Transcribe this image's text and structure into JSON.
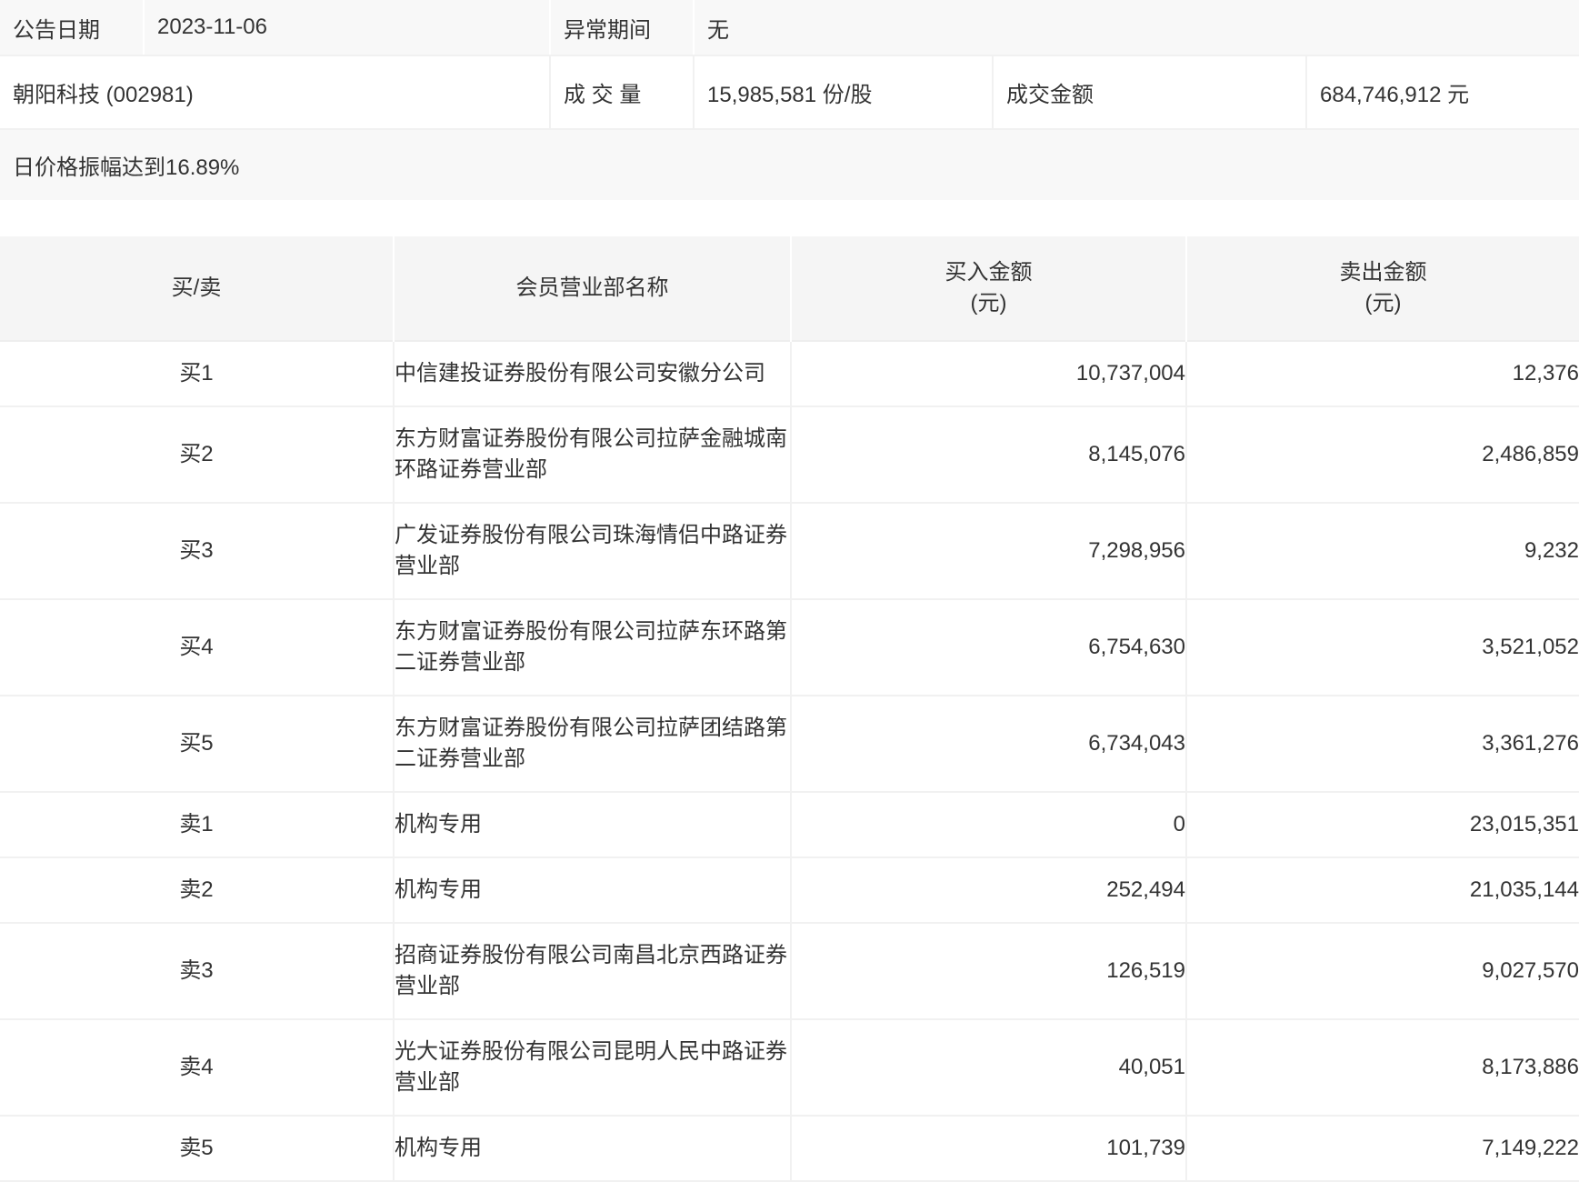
{
  "info": {
    "announce_date_label": "公告日期",
    "announce_date": "2023-11-06",
    "abnormal_period_label": "异常期间",
    "abnormal_period": "无",
    "stock_name": "朝阳科技 (002981)",
    "volume_label": "成 交 量",
    "volume_value": "15,985,581 份/股",
    "turnover_label": "成交金额",
    "turnover_value": "684,746,912 元",
    "reason_note": "日价格振幅达到16.89%"
  },
  "table": {
    "headers": [
      {
        "label": "买/卖",
        "sub": ""
      },
      {
        "label": "会员营业部名称",
        "sub": ""
      },
      {
        "label": "买入金额",
        "sub": "(元)"
      },
      {
        "label": "卖出金额",
        "sub": "(元)"
      }
    ],
    "rows": [
      {
        "side": "买1",
        "name": "中信建投证券股份有限公司安徽分公司",
        "buy": "10,737,004",
        "sell": "12,376"
      },
      {
        "side": "买2",
        "name": "东方财富证券股份有限公司拉萨金融城南环路证券营业部",
        "buy": "8,145,076",
        "sell": "2,486,859"
      },
      {
        "side": "买3",
        "name": "广发证券股份有限公司珠海情侣中路证券营业部",
        "buy": "7,298,956",
        "sell": "9,232"
      },
      {
        "side": "买4",
        "name": "东方财富证券股份有限公司拉萨东环路第二证券营业部",
        "buy": "6,754,630",
        "sell": "3,521,052"
      },
      {
        "side": "买5",
        "name": "东方财富证券股份有限公司拉萨团结路第二证券营业部",
        "buy": "6,734,043",
        "sell": "3,361,276"
      },
      {
        "side": "卖1",
        "name": "机构专用",
        "buy": "0",
        "sell": "23,015,351"
      },
      {
        "side": "卖2",
        "name": "机构专用",
        "buy": "252,494",
        "sell": "21,035,144"
      },
      {
        "side": "卖3",
        "name": "招商证券股份有限公司南昌北京西路证券营业部",
        "buy": "126,519",
        "sell": "9,027,570"
      },
      {
        "side": "卖4",
        "name": "光大证券股份有限公司昆明人民中路证券营业部",
        "buy": "40,051",
        "sell": "8,173,886"
      },
      {
        "side": "卖5",
        "name": "机构专用",
        "buy": "101,739",
        "sell": "7,149,222"
      }
    ]
  },
  "colors": {
    "text": "#333333",
    "summary_alt_row_bg": "#f8f8f8",
    "table_header_bg": "#f5f5f5",
    "border": "#f1f1f1"
  }
}
